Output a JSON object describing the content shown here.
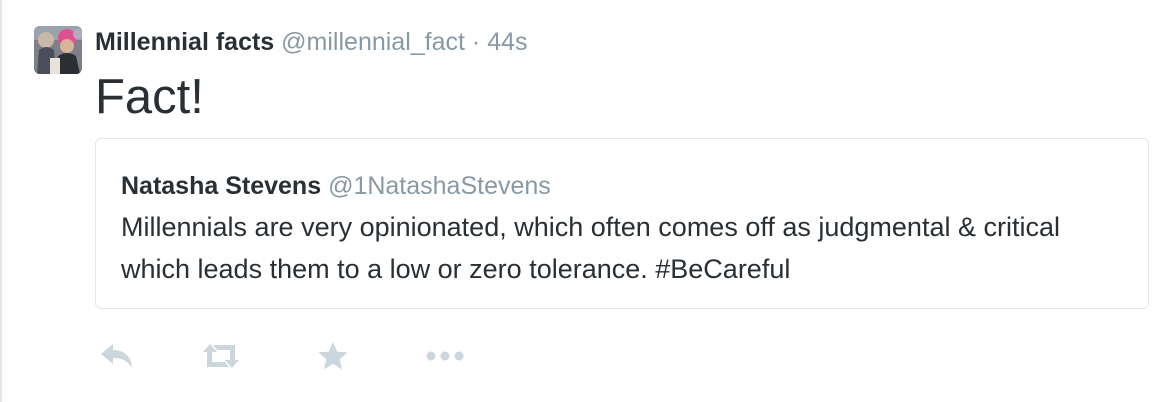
{
  "tweet": {
    "author_name": "Millennial facts",
    "author_handle": "@millennial_fact",
    "separator": "·",
    "timestamp": "44s",
    "text": "Fact!"
  },
  "quoted_tweet": {
    "author_name": "Natasha Stevens",
    "author_handle": "@1NatashaStevens",
    "text_line_1": "Millennials are very opinionated, which often comes off as judgmental & critical",
    "text_line_2": "which leads them to a low or zero tolerance. #BeCareful"
  },
  "actions": [
    {
      "icon": "reply-icon"
    },
    {
      "icon": "retweet-icon"
    },
    {
      "icon": "favorite-star-icon"
    },
    {
      "icon": "more-options-icon"
    }
  ],
  "colors": {
    "text_primary": "#292f33",
    "text_secondary": "#8899a6",
    "border": "#e1e8ed",
    "action_icon": "#ccd6dd"
  }
}
